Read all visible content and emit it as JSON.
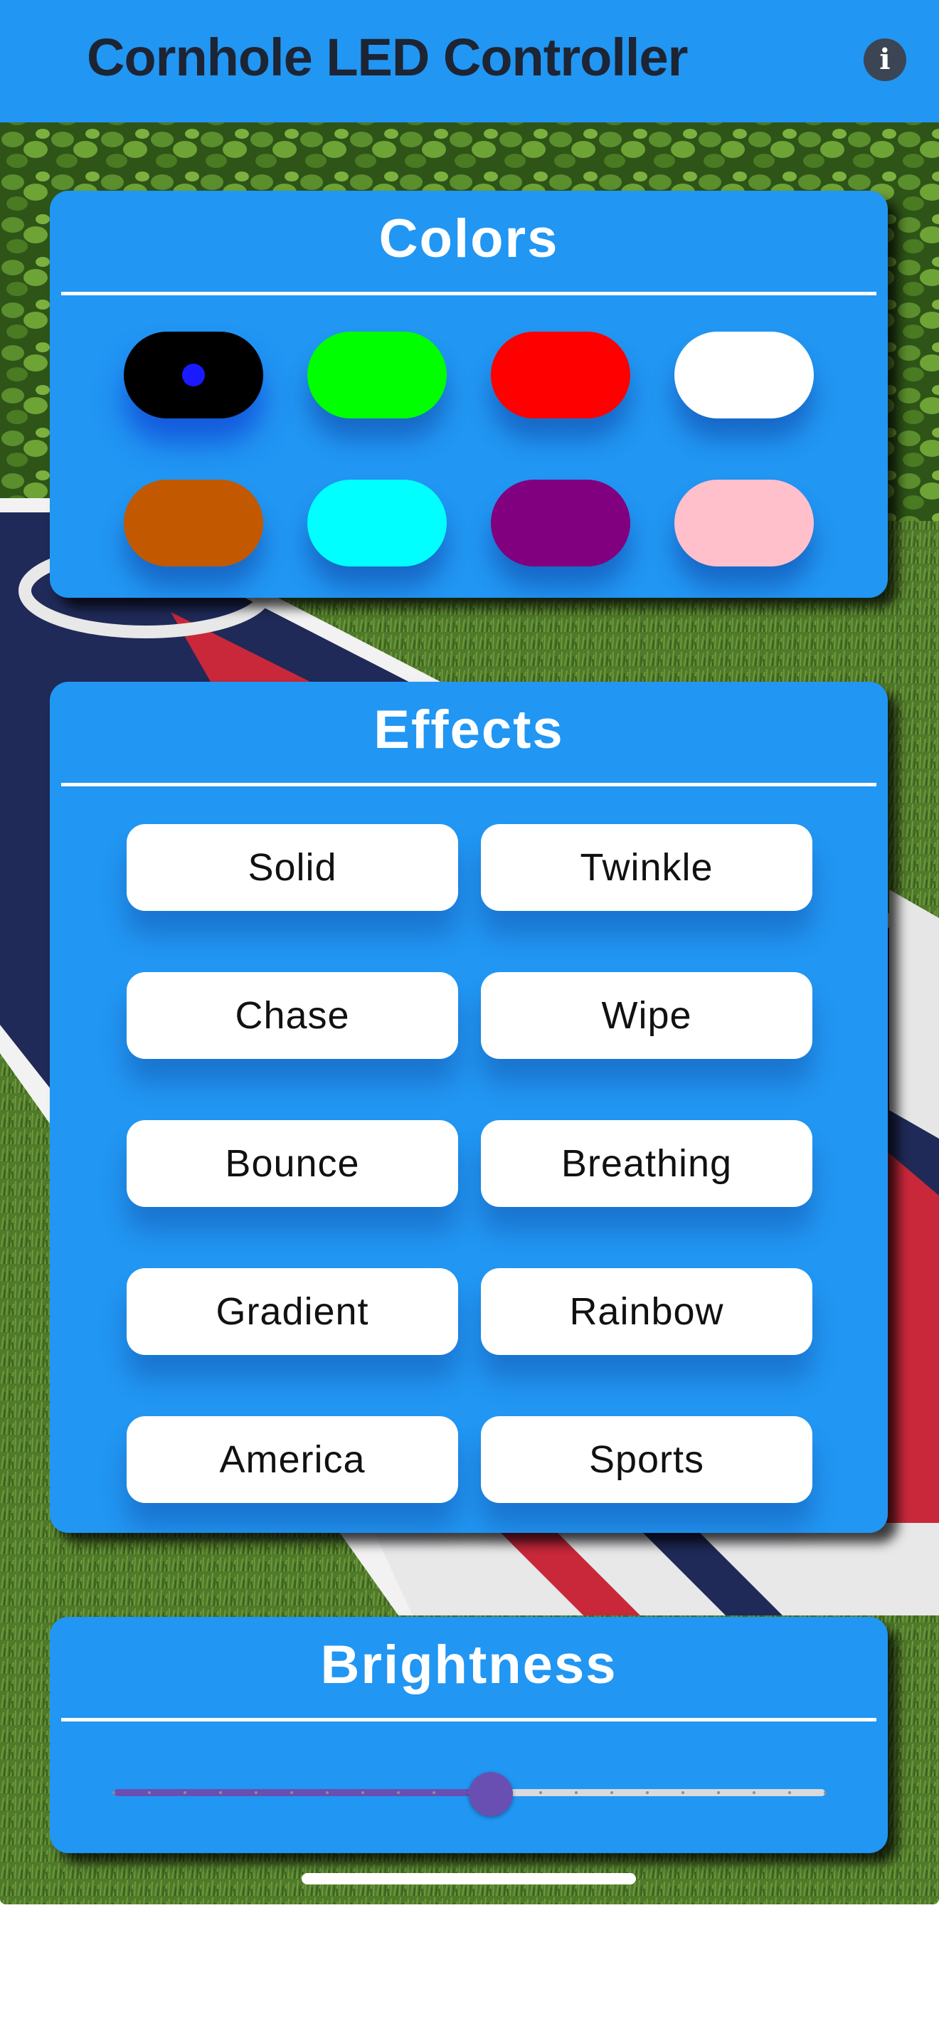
{
  "header": {
    "title": "Cornhole LED Controller",
    "info_icon": "info-icon"
  },
  "colors_card": {
    "title": "Colors",
    "swatches": [
      {
        "color": "#000000",
        "selected": true
      },
      {
        "color": "#00ff00",
        "selected": false
      },
      {
        "color": "#ff0000",
        "selected": false
      },
      {
        "color": "#ffffff",
        "selected": false
      },
      {
        "color": "#c25800",
        "selected": false
      },
      {
        "color": "#00ffff",
        "selected": false
      },
      {
        "color": "#800080",
        "selected": false
      },
      {
        "color": "#ffc0cb",
        "selected": false
      }
    ]
  },
  "effects_card": {
    "title": "Effects",
    "buttons": [
      "Solid",
      "Twinkle",
      "Chase",
      "Wipe",
      "Bounce",
      "Breathing",
      "Gradient",
      "Rainbow",
      "America",
      "Sports"
    ]
  },
  "brightness_card": {
    "title": "Brightness",
    "value_fraction": 0.53,
    "steps": 20
  },
  "theme": {
    "accent": "#2196f3",
    "slider": "#6a4fb3"
  }
}
